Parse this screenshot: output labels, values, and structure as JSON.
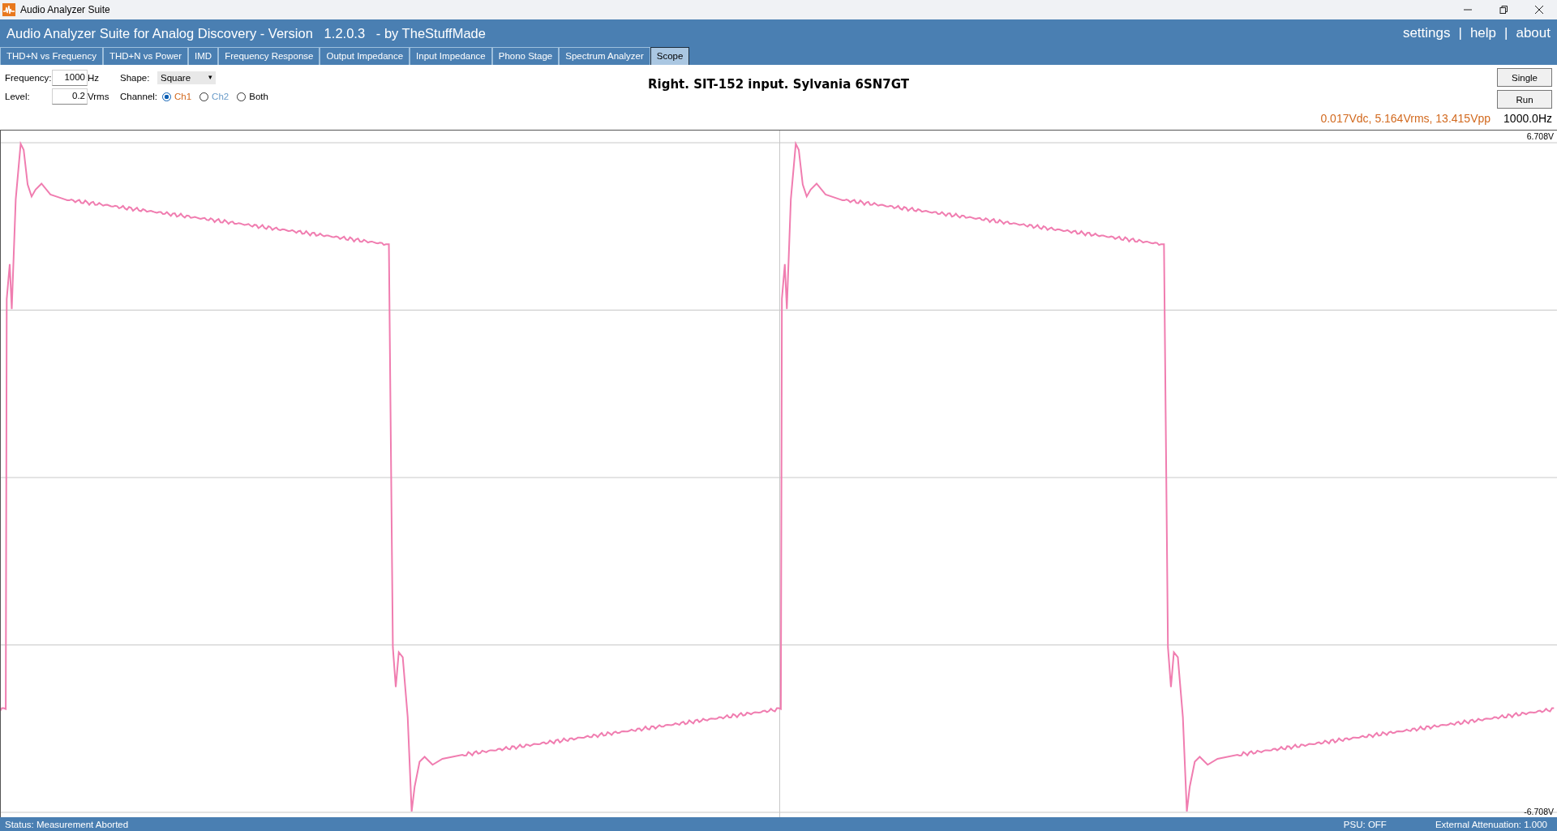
{
  "window": {
    "title": "Audio Analyzer Suite"
  },
  "header": {
    "title": "Audio Analyzer Suite for Analog Discovery - Version   1.2.0.3   - by TheStuffMade",
    "links": [
      {
        "label": "settings"
      },
      {
        "label": "help"
      },
      {
        "label": "about"
      }
    ],
    "separators": [
      "|",
      "|"
    ]
  },
  "tabs": [
    {
      "label": "THD+N vs Frequency",
      "selected": false
    },
    {
      "label": "THD+N vs Power",
      "selected": false
    },
    {
      "label": "IMD",
      "selected": false
    },
    {
      "label": "Frequency Response",
      "selected": false
    },
    {
      "label": "Output Impedance",
      "selected": false
    },
    {
      "label": "Input Impedance",
      "selected": false
    },
    {
      "label": "Phono Stage",
      "selected": false
    },
    {
      "label": "Spectrum Analyzer",
      "selected": false
    },
    {
      "label": "Scope",
      "selected": true
    }
  ],
  "controls": {
    "frequency": {
      "label": "Frequency:",
      "value": "1000",
      "unit": "Hz"
    },
    "level": {
      "label": "Level:",
      "value": "0.2",
      "unit": "Vrms"
    },
    "shape": {
      "label": "Shape:",
      "value": "Square",
      "caret": "▾"
    },
    "channel": {
      "label": "Channel:",
      "options": [
        {
          "label": "Ch1",
          "selected": true,
          "color": "#d2691e"
        },
        {
          "label": "Ch2",
          "selected": false,
          "color": "#6a9cc9"
        },
        {
          "label": "Both",
          "selected": false,
          "color": "#000000"
        }
      ]
    }
  },
  "chart_title": "Right. SIT-152 input. Sylvania 6SN7GT",
  "buttons": [
    "Single",
    "Run"
  ],
  "readout": {
    "measurements": "0.017Vdc, 5.164Vrms, 13.415Vpp",
    "frequency": "1000.0Hz"
  },
  "scope": {
    "y_max_label": "6.708V",
    "y_min_label": "-6.708V"
  },
  "status_bar": {
    "status": "Status: Measurement Aborted",
    "psu": "PSU: OFF",
    "attenuation": "External Attenuation: 1.000"
  }
}
